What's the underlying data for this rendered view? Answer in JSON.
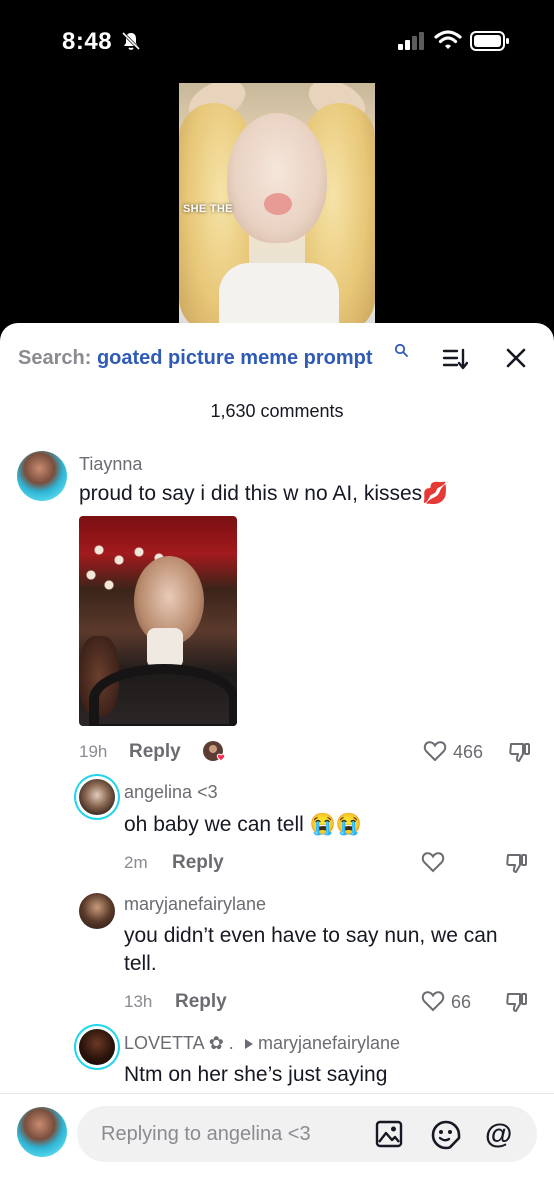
{
  "status_bar": {
    "time": "8:48"
  },
  "video": {
    "overlay_text": "SHE THE"
  },
  "search": {
    "prefix": "Search:",
    "query": "goated picture meme prompt"
  },
  "comment_count": "1,630 comments",
  "comments": [
    {
      "username": "Tiaynna",
      "text": "proud to say i did this w no AI, kisses💋",
      "time": "19h",
      "reply_label": "Reply",
      "likes": "466"
    },
    {
      "username": "angelina <3",
      "text": "oh baby we can tell 😭😭",
      "time": "2m",
      "reply_label": "Reply",
      "likes": ""
    },
    {
      "username": "maryjanefairylane",
      "text_line1": "you didn’t even have to say nun, we can",
      "text_line2": "tell.",
      "time": "13h",
      "reply_label": "Reply",
      "likes": "66"
    },
    {
      "username": "LOVETTA ✿ .",
      "reply_to": "maryjanefairylane",
      "text": "Ntm on her she’s just saying"
    }
  ],
  "reply_bar": {
    "placeholder": "Replying to angelina <3",
    "at_symbol": "@"
  },
  "colors": {
    "accent_blue": "#2f5bb7",
    "ring_cyan": "#20d5ec",
    "text_dark": "#161823",
    "text_gray": "#8a8b91"
  }
}
